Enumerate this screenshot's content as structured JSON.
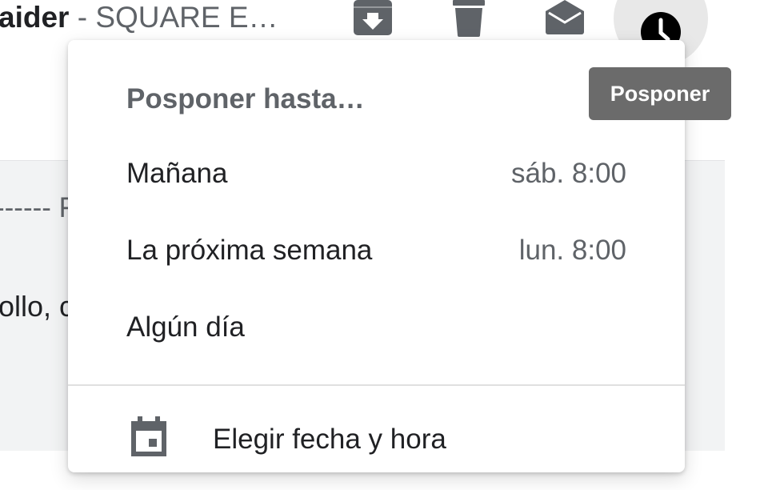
{
  "mail_row": {
    "sender": "aider",
    "separator": " - ",
    "subject": "SQUARE E…",
    "dashes": "------ F",
    "body_snippet": "ollo, c"
  },
  "toolbar": {
    "icons": [
      "archive-icon",
      "delete-icon",
      "mark-read-icon",
      "snooze-icon"
    ]
  },
  "snooze_menu": {
    "title": "Posponer hasta…",
    "items": [
      {
        "label": "Mañana",
        "time": "sáb. 8:00"
      },
      {
        "label": "La próxima semana",
        "time": "lun. 8:00"
      },
      {
        "label": "Algún día",
        "time": ""
      }
    ],
    "pick_label": "Elegir fecha y hora"
  },
  "tooltip": {
    "text": "Posponer"
  },
  "colors": {
    "icon_gray": "#5f6368",
    "tooltip_bg": "#6b6b6b",
    "band_bg": "#f2f3f4"
  }
}
